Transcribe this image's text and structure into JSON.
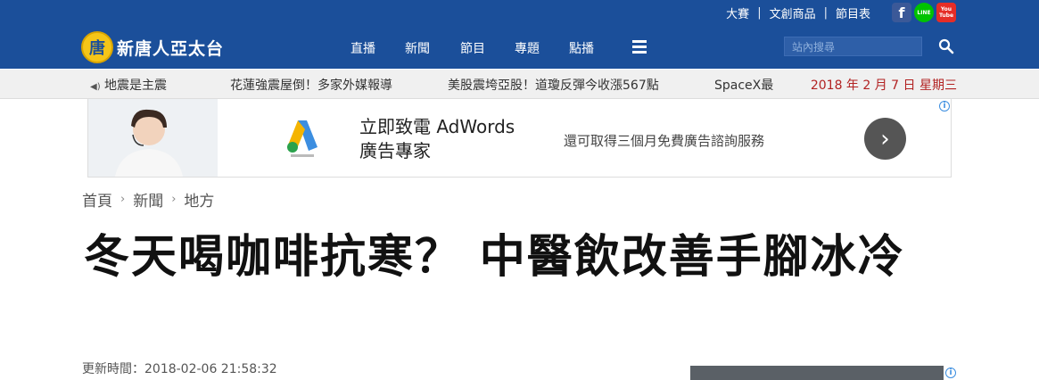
{
  "topbar": {
    "links": [
      "大賽",
      "文創商品",
      "節目表"
    ],
    "separator": "|",
    "social": [
      {
        "icon": "facebook-icon",
        "glyph": "f",
        "color": "#3b5998"
      },
      {
        "icon": "line-icon",
        "glyph": "LINE",
        "color": "#00c300"
      },
      {
        "icon": "youtube-icon",
        "glyph": "You\nTube",
        "color": "#e52d27"
      }
    ]
  },
  "logo": {
    "emblem": "唐",
    "text": "新唐人亞太台"
  },
  "nav": {
    "items": [
      "直播",
      "新聞",
      "節目",
      "專題",
      "點播"
    ]
  },
  "search": {
    "placeholder": "站內搜尋"
  },
  "ticker": {
    "items": [
      "地震是主震",
      "花蓮強震屋倒！多家外媒報導",
      "美股震垮亞股！道瓊反彈今收漲567點",
      "SpaceX最"
    ],
    "date": "2018 年 2 月 7 日 星期三"
  },
  "ad": {
    "headline_line1": "立即致電 AdWords",
    "headline_line2": "廣告專家",
    "subtext": "還可取得三個月免費廣告諮詢服務",
    "info": "i"
  },
  "breadcrumb": [
    "首頁",
    "新聞",
    "地方"
  ],
  "article": {
    "title": "冬天喝咖啡抗寒？ 中醫飲改善手腳冰冷",
    "updated_label": "更新時間：",
    "updated_time": "2018-02-06 21:58:32"
  },
  "colors": {
    "brand": "#1b4f9a",
    "ticker_bg": "#f0f0f0",
    "date": "#b22222"
  }
}
